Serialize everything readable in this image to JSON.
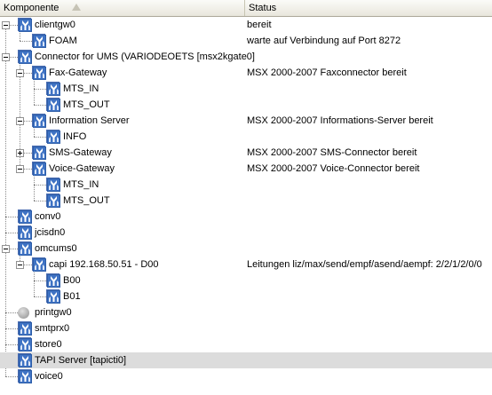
{
  "columns": {
    "component": "Komponente",
    "status": "Status"
  },
  "rows": [
    {
      "label": "clientgw0",
      "status": "bereit",
      "icon": "service-icon"
    },
    {
      "label": "FOAM",
      "status": "warte auf Verbindung auf Port 8272",
      "icon": "service-icon"
    },
    {
      "label": "Connector for UMS (VARIODEOETS [msx2kgate0]",
      "status": "",
      "icon": "service-icon"
    },
    {
      "label": "Fax-Gateway",
      "status": "MSX 2000-2007 Faxconnector bereit",
      "icon": "service-icon"
    },
    {
      "label": "MTS_IN",
      "status": "",
      "icon": "service-icon"
    },
    {
      "label": "MTS_OUT",
      "status": "",
      "icon": "service-icon"
    },
    {
      "label": "Information Server",
      "status": "MSX 2000-2007 Informations-Server bereit",
      "icon": "service-icon"
    },
    {
      "label": "INFO",
      "status": "",
      "icon": "service-icon"
    },
    {
      "label": "SMS-Gateway",
      "status": "MSX 2000-2007 SMS-Connector bereit",
      "icon": "service-icon"
    },
    {
      "label": "Voice-Gateway",
      "status": "MSX 2000-2007 Voice-Connector bereit",
      "icon": "service-icon"
    },
    {
      "label": "MTS_IN",
      "status": "",
      "icon": "service-icon"
    },
    {
      "label": "MTS_OUT",
      "status": "",
      "icon": "service-icon"
    },
    {
      "label": "conv0",
      "status": "",
      "icon": "service-icon"
    },
    {
      "label": "jcisdn0",
      "status": "",
      "icon": "service-icon"
    },
    {
      "label": "omcums0",
      "status": "",
      "icon": "service-icon"
    },
    {
      "label": "capi 192.168.50.51 - D00",
      "status": "Leitungen liz/max/send/empf/asend/aempf: 2/2/1/2/0/0",
      "icon": "service-icon"
    },
    {
      "label": "B00",
      "status": "",
      "icon": "service-icon"
    },
    {
      "label": "B01",
      "status": "",
      "icon": "service-icon"
    },
    {
      "label": "printgw0",
      "status": "",
      "icon": "inactive-service-icon"
    },
    {
      "label": "smtprx0",
      "status": "",
      "icon": "service-icon"
    },
    {
      "label": "store0",
      "status": "",
      "icon": "service-icon"
    },
    {
      "label": "TAPI Server [tapicti0]",
      "status": "",
      "icon": "service-icon"
    },
    {
      "label": "voice0",
      "status": "",
      "icon": "service-icon"
    }
  ],
  "colors": {
    "icon_blue": "#2e5ea8",
    "selection": "#dcdcdc",
    "header": "#ece9d8"
  }
}
